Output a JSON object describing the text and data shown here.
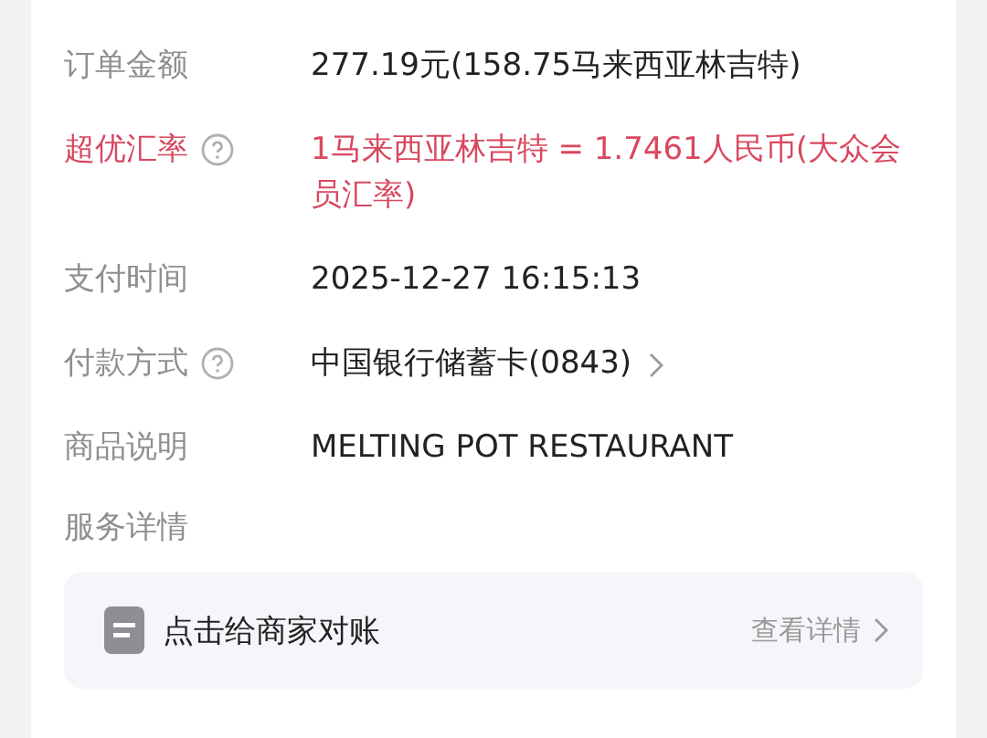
{
  "rows": [
    {
      "label": "订单金额",
      "value": "277.19元(158.75马来西亚林吉特)",
      "highlight": false,
      "help": false,
      "link": false
    },
    {
      "label": "超优汇率",
      "value": "1马来西亚林吉特 = 1.7461人民币(大众会员汇率)",
      "highlight": true,
      "help": true,
      "link": false
    },
    {
      "label": "支付时间",
      "value": "2025-12-27 16:15:13",
      "highlight": false,
      "help": false,
      "link": false
    },
    {
      "label": "付款方式",
      "value": "中国银行储蓄卡(0843)",
      "highlight": false,
      "help": true,
      "link": true
    },
    {
      "label": "商品说明",
      "value": "MELTING POT RESTAURANT",
      "highlight": false,
      "help": false,
      "link": false
    }
  ],
  "service": {
    "label": "服务详情",
    "card": {
      "title": "点击给商家对账",
      "action": "查看详情"
    }
  }
}
